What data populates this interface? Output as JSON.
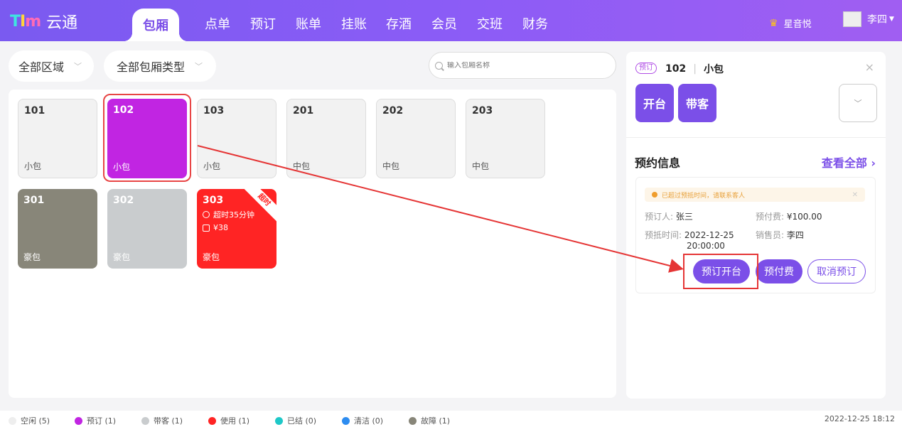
{
  "header": {
    "logo_text": "云通",
    "nav": [
      "包厢",
      "点单",
      "预订",
      "账单",
      "挂账",
      "存酒",
      "会员",
      "交班",
      "财务"
    ],
    "vip_name": "星音悦",
    "user_name": "李四"
  },
  "filters": {
    "area": "全部区域",
    "room_type": "全部包厢类型",
    "search_placeholder": "输入包厢名称"
  },
  "rooms": [
    {
      "number": "101",
      "type": "小包",
      "status": "idle"
    },
    {
      "number": "102",
      "type": "小包",
      "status": "booked"
    },
    {
      "number": "103",
      "type": "小包",
      "status": "idle"
    },
    {
      "number": "201",
      "type": "中包",
      "status": "idle"
    },
    {
      "number": "202",
      "type": "中包",
      "status": "idle"
    },
    {
      "number": "203",
      "type": "中包",
      "status": "idle"
    },
    {
      "number": "301",
      "type": "豪包",
      "status": "broken"
    },
    {
      "number": "302",
      "type": "豪包",
      "status": "guest"
    },
    {
      "number": "303",
      "type": "豪包",
      "status": "inuse",
      "overtime": "超时35分钟",
      "amount": "¥38",
      "ribbon": "超时"
    }
  ],
  "detail": {
    "badge": "预订",
    "room_number": "102",
    "room_type": "小包",
    "close": "×",
    "open_btn": "开台",
    "guest_btn": "带客",
    "section_title": "预约信息",
    "view_all": "查看全部 ›",
    "warning": "已超过预抵时间，请联系客人",
    "booker_label": "预订人:",
    "booker": "张三",
    "prepay_label": "预付费:",
    "prepay": "¥100.00",
    "arrive_label": "预抵时间:",
    "arrive_date": "2022-12-25",
    "arrive_time": "20:00:00",
    "sales_label": "销售员:",
    "sales": "李四",
    "btn_open": "预订开台",
    "btn_prepay": "预付费",
    "btn_cancel": "取消预订"
  },
  "legend": [
    {
      "label": "空闲 (5)",
      "color": "#eeeeee"
    },
    {
      "label": "预订 (1)",
      "color": "#c125e2"
    },
    {
      "label": "带客 (1)",
      "color": "#c9ccce"
    },
    {
      "label": "使用 (1)",
      "color": "#ff2424"
    },
    {
      "label": "已结 (0)",
      "color": "#1ec8c8"
    },
    {
      "label": "清洁 (0)",
      "color": "#2d8cf0"
    },
    {
      "label": "故障 (1)",
      "color": "#888679"
    }
  ],
  "datetime": "2022-12-25 18:12"
}
